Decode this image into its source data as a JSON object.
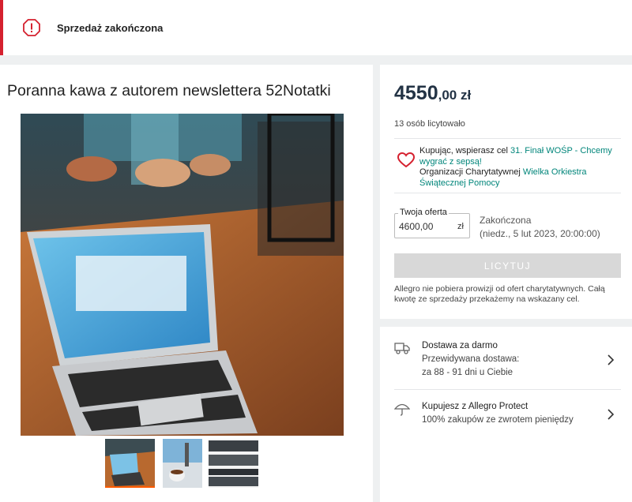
{
  "banner": {
    "status_text": "Sprzedaż zakończona",
    "icon": "warning-octagon-icon",
    "color": "#d5212f"
  },
  "offer": {
    "title": "Poranna kawa z autorem newslettera 52Notatki",
    "thumbnails": [
      {
        "name": "thumbnail-laptop",
        "active": true
      },
      {
        "name": "thumbnail-coffee",
        "active": false
      },
      {
        "name": "thumbnail-screens",
        "active": false
      }
    ]
  },
  "purchase": {
    "price_main": "4550",
    "price_cents": ",00 zł",
    "bidders": "13 osób licytowało",
    "charity": {
      "prefix": "Kupując, wspierasz cel ",
      "goal_link": "31. Finał WOŚP - Chcemy wygrać z sepsą!",
      "org_prefix": "Organizacji Charytatywnej ",
      "org_link": "Wielka Orkiestra Świątecznej Pomocy"
    },
    "your_offer_label": "Twoja oferta",
    "your_offer_value": "4600,00",
    "currency": "zł",
    "status": "Zakończona",
    "end_date": "(niedz., 5 lut 2023, 20:00:00)",
    "bid_button": "LICYTUJ",
    "note": "Allegro nie pobiera prowizji od ofert charytatywnych. Całą kwotę ze sprzedaży przekażemy na wskazany cel."
  },
  "delivery": {
    "title": "Dostawa za darmo",
    "line1": "Przewidywana dostawa:",
    "line2": "za 88 - 91 dni u Ciebie",
    "icon": "truck-icon"
  },
  "protect": {
    "title": "Kupujesz z Allegro Protect",
    "line1": "100% zakupów ze zwrotem pieniędzy",
    "icon": "umbrella-icon"
  },
  "colors": {
    "accent": "#00857a",
    "price": "#233345",
    "alert": "#d5212f"
  }
}
